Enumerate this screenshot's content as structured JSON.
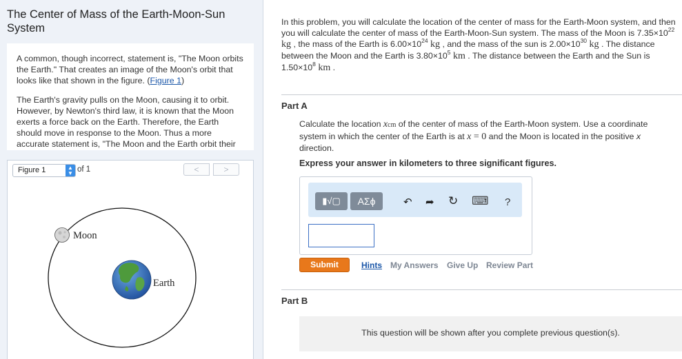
{
  "left": {
    "title": "The Center of Mass of the Earth-Moon-Sun System",
    "intro_p1_text": "A common, though incorrect, statement is, \"The Moon orbits the Earth.\" That creates an image of the Moon's orbit that looks like that shown in the figure. (",
    "intro_p1_link": "Figure 1",
    "intro_p1_end": ")",
    "intro_p2": "The Earth's gravity pulls on the Moon, causing it to orbit. However, by Newton's third law, it is known that the Moon exerts a force back on the Earth. Therefore, the Earth should move in response to the Moon. Thus a more accurate statement is, \"The Moon and the Earth orbit their common center of mass.\""
  },
  "figure": {
    "selector_label": "Figure 1",
    "of_label": "of 1",
    "prev_glyph": "<",
    "next_glyph": ">",
    "moon_label": "Moon",
    "earth_label": "Earth"
  },
  "problem": {
    "s1": "In this problem, you will calculate the location of the center of mass for the Earth-Moon system, and then you will calculate the center of mass of the Earth-Moon-Sun system. The mass of the Moon is ",
    "moon_mass_base": "7.35×10",
    "moon_mass_exp": "22",
    "unit_kg": "kg",
    "s2": ", the mass of the Earth is ",
    "earth_mass_base": "6.00×10",
    "earth_mass_exp": "24",
    "s3": ", and the mass of the sun is ",
    "sun_mass_base": "2.00×10",
    "sun_mass_exp": "30",
    "s4": ". The distance between the Moon and the Earth is ",
    "em_dist_base": "3.80×10",
    "em_dist_exp": "5",
    "unit_km": "km",
    "s5": ". The distance between the Earth and the Sun is ",
    "es_dist_base": "1.50×10",
    "es_dist_exp": "8",
    "s6": "."
  },
  "part_a": {
    "label": "Part A",
    "q1": "Calculate the location ",
    "var_x": "x",
    "var_sub": "cm",
    "q2": " of the center of mass of the Earth-Moon system. Use a coordinate system in which the center of the Earth is at ",
    "eq_x": "x",
    "eq_rest": " = 0",
    "q3": " and the Moon is located in the positive ",
    "q3_var": "x",
    "q4": " direction.",
    "instructions": "Express your answer in kilometers to three significant figures.",
    "toolbar_template_label": "▮√▢",
    "toolbar_greek_label": "ΑΣϕ",
    "undo_icon": "↶",
    "redo_icon": "➦",
    "reset_icon": "↻",
    "keyboard_icon": "⌨",
    "help_label": "?",
    "answer_value": "",
    "submit_label": "Submit",
    "hints_label": "Hints",
    "my_answers_label": "My Answers",
    "give_up_label": "Give Up",
    "review_part_label": "Review Part"
  },
  "part_b": {
    "label": "Part B",
    "message": "This question will be shown after you complete previous question(s)."
  },
  "colors": {
    "accent_link": "#1a56a8",
    "submit_orange": "#e8781b",
    "toolbar_blue": "#d9e9f8",
    "left_bg": "#eef2f8"
  }
}
